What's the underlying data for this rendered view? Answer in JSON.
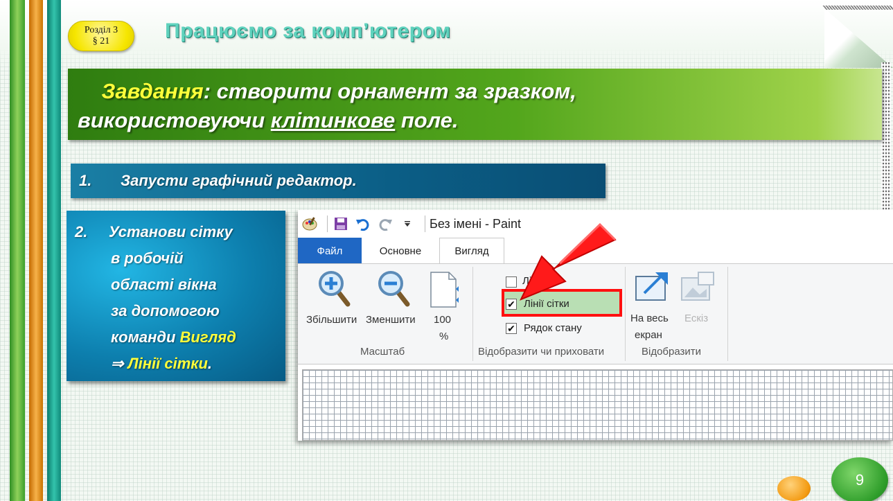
{
  "badge": {
    "line1": "Розділ 3",
    "line2": "§ 21"
  },
  "page_title": "Працюємо за комп’ютером",
  "task": {
    "word": "Завдання",
    "rest1": ": створити орнамент за  зразком,",
    "line2_a": "використовуючи ",
    "line2_b": "клітинкове",
    "line2_c": " поле."
  },
  "step1": {
    "num": "1.",
    "text": "Запусти графічний редактор."
  },
  "step2": {
    "num": "2.",
    "l1": "Установи сітку",
    "l2": "в робочій",
    "l3": "області вікна",
    "l4": "за допомогою",
    "l5a": "команди ",
    "l5b": "Вигляд",
    "l6a": "⇒ ",
    "l6b": "Лінії сітки",
    "l6c": "."
  },
  "paint": {
    "window_title": "Без імені - Paint",
    "tabs": {
      "file": "Файл",
      "home": "Основне",
      "view": "Вигляд"
    },
    "zoom_in": "Збільшити",
    "zoom_out": "Зменшити",
    "zoom100_a": "100",
    "zoom100_b": "%",
    "group_zoom": "Масштаб",
    "rulers": "Лінійки",
    "gridlines": "Лінії сітки",
    "statusbar": "Рядок стану",
    "group_show": "Відобразити чи приховати",
    "fullscreen_a": "На весь",
    "fullscreen_b": "екран",
    "thumbnail": "Ескіз",
    "group_display": "Відобразити",
    "gridlines_checked": true,
    "statusbar_checked": true,
    "rulers_checked": false
  },
  "page_number": "9",
  "colors": {
    "accent_red": "#ff1010",
    "paint_file_tab": "#1f67c4"
  }
}
